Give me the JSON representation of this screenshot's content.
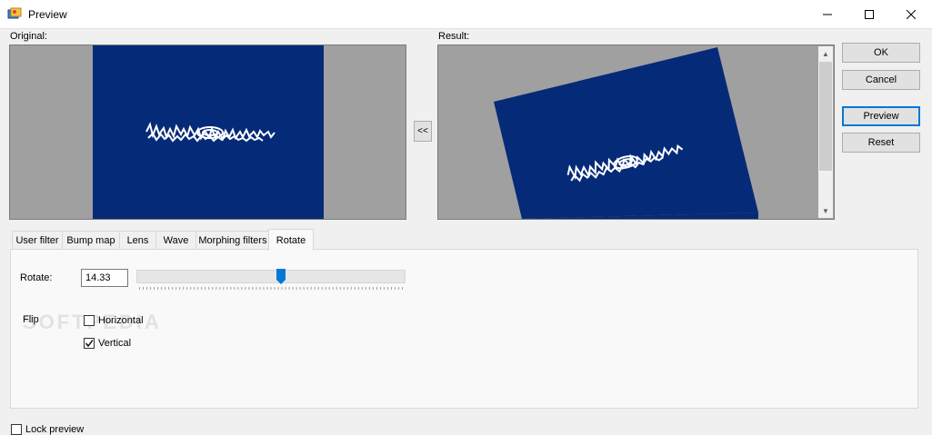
{
  "window": {
    "title": "Preview",
    "controls": [
      "minimize-icon",
      "maximize-icon",
      "close-icon"
    ]
  },
  "labels": {
    "original": "Original:",
    "result": "Result:"
  },
  "swap_label": "<<",
  "buttons": {
    "ok": "OK",
    "cancel": "Cancel",
    "preview": "Preview",
    "reset": "Reset"
  },
  "tabs": [
    {
      "label": "User filter"
    },
    {
      "label": "Bump map"
    },
    {
      "label": "Lens"
    },
    {
      "label": "Wave"
    },
    {
      "label": "Morphing filters"
    },
    {
      "label": "Rotate",
      "active": true
    }
  ],
  "rotate": {
    "label": "Rotate:",
    "value": "14.33",
    "slider_fraction": 0.54
  },
  "flip": {
    "label": "Flip",
    "horizontal": {
      "label": "Horizontal",
      "checked": false
    },
    "vertical": {
      "label": "Vertical",
      "checked": true
    }
  },
  "lock_preview": {
    "label": "Lock preview",
    "checked": false
  },
  "watermark": "SOFTPEDIA",
  "colors": {
    "image_blue": "#052a78",
    "canvas_gray": "#a0a0a0",
    "accent": "#0078d7"
  }
}
